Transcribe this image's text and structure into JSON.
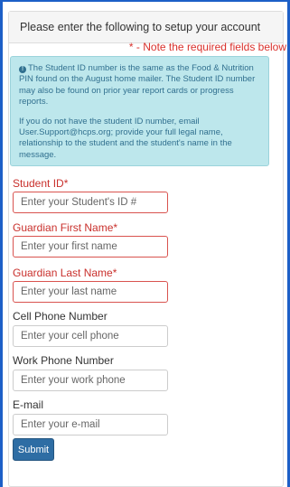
{
  "panel": {
    "heading": "Please enter the following to setup your account",
    "required_note": "* - Note the required fields below"
  },
  "alert": {
    "icon": "info-icon",
    "paragraph1": "The Student ID number is the same as the Food & Nutrition PIN found on the August home mailer. The Student ID number may also be found on prior year report cards or progress reports.",
    "paragraph2": "If you do not have the student ID number, email User.Support@hcps.org; provide your full legal name, relationship to the student and the student's name in the message."
  },
  "form": {
    "student_id": {
      "label": "Student ID*",
      "placeholder": "Enter your Student's ID #",
      "value": ""
    },
    "guardian_first": {
      "label": "Guardian First Name*",
      "placeholder": "Enter your first name",
      "value": ""
    },
    "guardian_last": {
      "label": "Guardian Last Name*",
      "placeholder": "Enter your last name",
      "value": ""
    },
    "cell_phone": {
      "label": "Cell Phone Number",
      "placeholder": "Enter your cell phone",
      "value": ""
    },
    "work_phone": {
      "label": "Work Phone Number",
      "placeholder": "Enter your work phone",
      "value": ""
    },
    "email": {
      "label": "E-mail",
      "placeholder": "Enter your e-mail",
      "value": ""
    },
    "submit_label": "Submit"
  },
  "colors": {
    "required": "#c9302c",
    "alert_bg": "#bde7ec",
    "button": "#2e6da4",
    "frame": "#1d5fc7"
  }
}
